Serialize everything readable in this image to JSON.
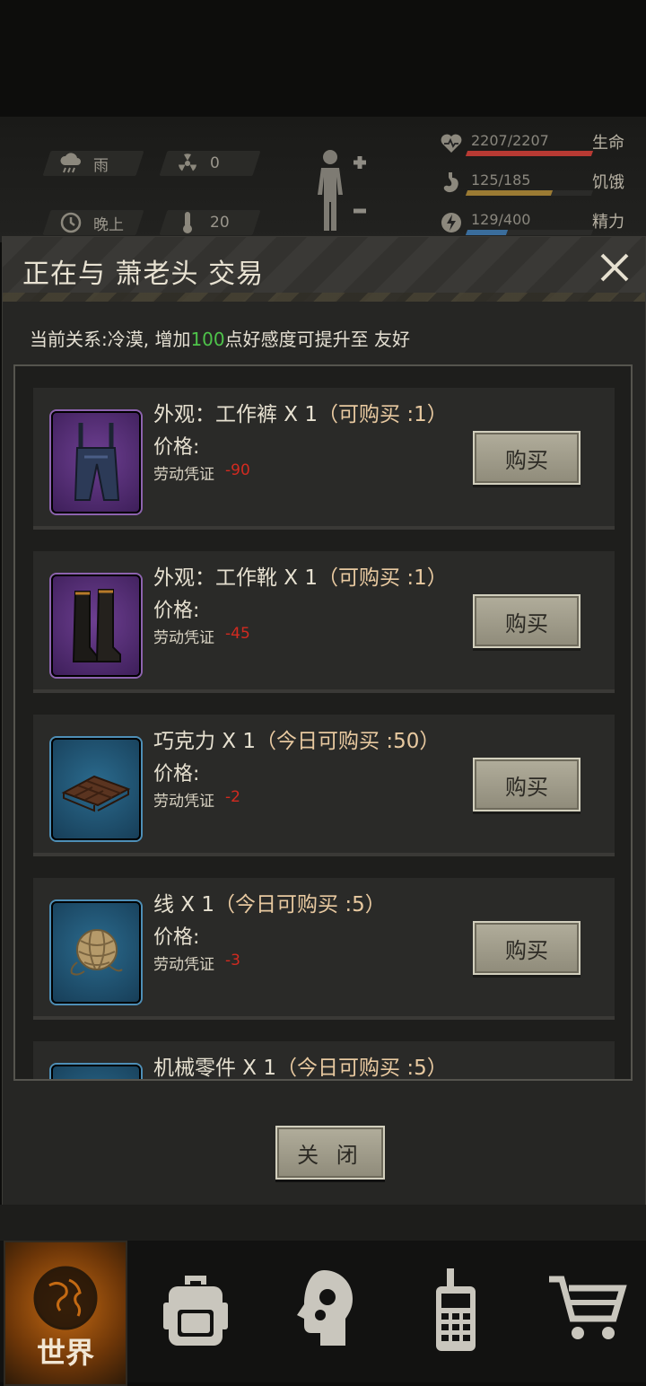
{
  "hud": {
    "weather": {
      "icon": "rain-cloud-icon",
      "text": "雨"
    },
    "radiation": {
      "icon": "radiation-icon",
      "text": "0"
    },
    "time_of_day": {
      "icon": "clock-icon",
      "text": "晚上"
    },
    "temperature": {
      "icon": "thermometer-icon",
      "text": "20"
    },
    "vitals": [
      {
        "icon": "heart-icon",
        "value": "2207/2207",
        "label": "生命",
        "fraction": 1.0,
        "color": "#b83a33"
      },
      {
        "icon": "stomach-icon",
        "value": "125/185",
        "label": "饥饿",
        "fraction": 0.676,
        "color": "#9b7b33"
      },
      {
        "icon": "energy-icon",
        "value": "129/400",
        "label": "精力",
        "fraction": 0.3225,
        "color": "#3a6d9c"
      }
    ]
  },
  "dialog": {
    "title": "正在与 萧老头 交易",
    "relation_prefix": "当前关系:冷漠, 增加",
    "relation_points": "100",
    "relation_suffix": "点好感度可提升至 友好",
    "close_label": "关 闭",
    "items": [
      {
        "name": "外观：工作裤 X 1",
        "limit": "（可购买 :1）",
        "price_label": "价格:",
        "currency": "劳动凭证",
        "price": "-90",
        "icon": "overalls-icon",
        "rarity": "purple",
        "buy_label": "购买"
      },
      {
        "name": "外观：工作靴 X 1",
        "limit": "（可购买 :1）",
        "price_label": "价格:",
        "currency": "劳动凭证",
        "price": "-45",
        "icon": "boots-icon",
        "rarity": "purple",
        "buy_label": "购买"
      },
      {
        "name": "巧克力 X 1",
        "limit": "（今日可购买 :50）",
        "price_label": "价格:",
        "currency": "劳动凭证",
        "price": "-2",
        "icon": "chocolate-icon",
        "rarity": "blue",
        "buy_label": "购买"
      },
      {
        "name": "线 X 1",
        "limit": "（今日可购买 :5）",
        "price_label": "价格:",
        "currency": "劳动凭证",
        "price": "-3",
        "icon": "thread-ball-icon",
        "rarity": "blue",
        "buy_label": "购买"
      },
      {
        "name": "机械零件 X 1",
        "limit": "（今日可购买 :5）",
        "icon": "mechanical-part-icon",
        "rarity": "blue"
      }
    ]
  },
  "nav": {
    "world_label": "世界",
    "items": [
      "globe-icon",
      "backpack-icon",
      "head-gear-icon",
      "radio-phone-icon",
      "cart-icon"
    ]
  }
}
